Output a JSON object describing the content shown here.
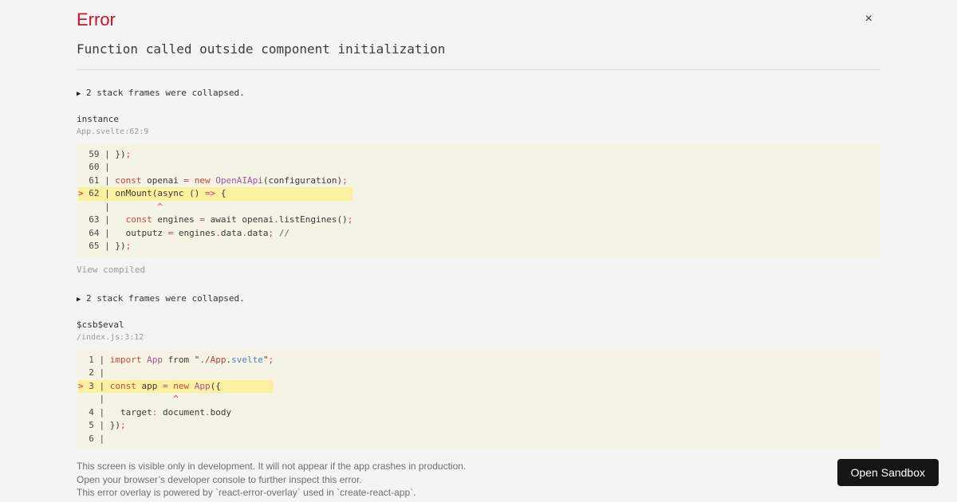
{
  "page": {
    "background": "#f4f4f4"
  },
  "header": {
    "title": "Error",
    "title_color": "#ce1126",
    "close_icon": "×"
  },
  "error": {
    "message": "Function called outside component initialization"
  },
  "syntax_colors": {
    "g": "#4a4a4a",
    "p": "#393939",
    "k": "#c8463c",
    "cl": "#a0569e",
    "o": "#c43d78",
    "s": "#a94442",
    "b": "#4e7dc4",
    "cm": "#666666",
    "r": "#d02b2b"
  },
  "code_background": "#f5f3e3",
  "code_highlight_background": "#fbf0a0",
  "frames": [
    {
      "collapsed_icon": "▶",
      "collapsed_label": "2 stack frames were collapsed.",
      "fn": "instance",
      "location": "App.svelte:62:9",
      "view_label": "View compiled",
      "code_lines": [
        {
          "hl": false,
          "tokens": [
            [
              "g",
              "  59 | "
            ],
            [
              "p",
              "})"
            ],
            [
              "o",
              ";"
            ]
          ]
        },
        {
          "hl": false,
          "tokens": [
            [
              "g",
              "  60 | "
            ]
          ]
        },
        {
          "hl": false,
          "tokens": [
            [
              "g",
              "  61 | "
            ],
            [
              "k",
              "const"
            ],
            [
              "p",
              " openai "
            ],
            [
              "o",
              "="
            ],
            [
              "p",
              " "
            ],
            [
              "k",
              "new"
            ],
            [
              "p",
              " "
            ],
            [
              "cl",
              "OpenAIApi"
            ],
            [
              "p",
              "(configuration)"
            ],
            [
              "o",
              ";"
            ]
          ]
        },
        {
          "hl": true,
          "tokens": [
            [
              "r",
              "> "
            ],
            [
              "g",
              "62 | "
            ],
            [
              "p",
              "onMount(async () "
            ],
            [
              "o",
              "=>"
            ],
            [
              "p",
              " {"
            ]
          ]
        },
        {
          "hl": false,
          "tokens": [
            [
              "g",
              "     | "
            ],
            [
              "p",
              "        "
            ],
            [
              "o",
              "^"
            ]
          ]
        },
        {
          "hl": false,
          "tokens": [
            [
              "g",
              "  63 | "
            ],
            [
              "p",
              "  "
            ],
            [
              "k",
              "const"
            ],
            [
              "p",
              " engines "
            ],
            [
              "o",
              "="
            ],
            [
              "p",
              " await openai"
            ],
            [
              "o",
              "."
            ],
            [
              "p",
              "listEngines()"
            ],
            [
              "o",
              ";"
            ]
          ]
        },
        {
          "hl": false,
          "tokens": [
            [
              "g",
              "  64 | "
            ],
            [
              "p",
              "  outputz "
            ],
            [
              "o",
              "="
            ],
            [
              "p",
              " engines"
            ],
            [
              "o",
              "."
            ],
            [
              "p",
              "data"
            ],
            [
              "o",
              "."
            ],
            [
              "p",
              "data"
            ],
            [
              "o",
              ";"
            ],
            [
              "cm",
              " //"
            ]
          ]
        },
        {
          "hl": false,
          "tokens": [
            [
              "g",
              "  65 | "
            ],
            [
              "p",
              "})"
            ],
            [
              "o",
              ";"
            ]
          ]
        }
      ]
    },
    {
      "collapsed_icon": "▶",
      "collapsed_label": "2 stack frames were collapsed.",
      "fn": "$csb$eval",
      "location": "/index.js:3:12",
      "view_label": null,
      "code_lines": [
        {
          "hl": false,
          "tokens": [
            [
              "g",
              "  1 | "
            ],
            [
              "k",
              "import"
            ],
            [
              "p",
              " "
            ],
            [
              "cl",
              "App"
            ],
            [
              "p",
              " from \""
            ],
            [
              "s",
              "./App"
            ],
            [
              "p",
              "."
            ],
            [
              "b",
              "svelte"
            ],
            [
              "p",
              "\""
            ],
            [
              "o",
              ";"
            ]
          ]
        },
        {
          "hl": false,
          "tokens": [
            [
              "g",
              "  2 | "
            ]
          ]
        },
        {
          "hl": true,
          "tokens": [
            [
              "r",
              "> "
            ],
            [
              "g",
              "3 | "
            ],
            [
              "k",
              "const"
            ],
            [
              "p",
              " app "
            ],
            [
              "o",
              "="
            ],
            [
              "p",
              " "
            ],
            [
              "k",
              "new"
            ],
            [
              "p",
              " "
            ],
            [
              "cl",
              "App"
            ],
            [
              "p",
              "({"
            ]
          ]
        },
        {
          "hl": false,
          "tokens": [
            [
              "g",
              "    | "
            ],
            [
              "p",
              "            "
            ],
            [
              "o",
              "^"
            ]
          ]
        },
        {
          "hl": false,
          "tokens": [
            [
              "g",
              "  4 | "
            ],
            [
              "p",
              "  target"
            ],
            [
              "o",
              ":"
            ],
            [
              "p",
              " document"
            ],
            [
              "o",
              "."
            ],
            [
              "p",
              "body"
            ]
          ]
        },
        {
          "hl": false,
          "tokens": [
            [
              "g",
              "  5 | "
            ],
            [
              "p",
              "})"
            ],
            [
              "o",
              ";"
            ]
          ]
        },
        {
          "hl": false,
          "tokens": [
            [
              "g",
              "  6 | "
            ]
          ]
        }
      ]
    }
  ],
  "footer": {
    "lines": [
      "This screen is visible only in development. It will not appear if the app crashes in production.",
      "Open your browser’s developer console to further inspect this error.",
      "This error overlay is powered by `react-error-overlay` used in `create-react-app`."
    ],
    "open_sandbox_label": "Open Sandbox"
  }
}
